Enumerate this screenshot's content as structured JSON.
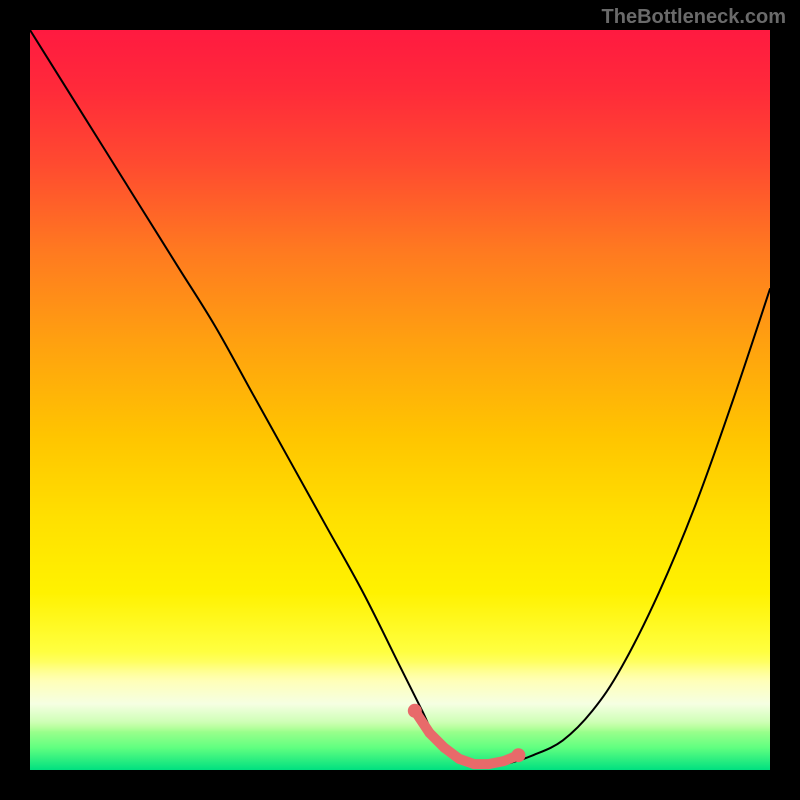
{
  "watermark": "TheBottleneck.com",
  "chart_data": {
    "type": "line",
    "title": "",
    "xlabel": "",
    "ylabel": "",
    "xlim": [
      0,
      100
    ],
    "ylim": [
      0,
      100
    ],
    "grid": false,
    "legend": false,
    "series": [
      {
        "name": "bottleneck-curve",
        "x": [
          0,
          5,
          10,
          15,
          20,
          25,
          30,
          35,
          40,
          45,
          50,
          53,
          55,
          58,
          60,
          62,
          65,
          68,
          72,
          76,
          80,
          85,
          90,
          95,
          100
        ],
        "values": [
          100,
          92,
          84,
          76,
          68,
          60,
          51,
          42,
          33,
          24,
          14,
          8,
          4,
          1.5,
          0.5,
          0.5,
          1,
          2,
          4,
          8,
          14,
          24,
          36,
          50,
          65
        ]
      }
    ],
    "markers": {
      "name": "highlight-points",
      "color": "#e86a6a",
      "x": [
        52,
        54,
        56,
        58,
        60,
        62,
        64,
        66
      ],
      "values": [
        8,
        5,
        3,
        1.5,
        0.8,
        0.8,
        1.2,
        2
      ]
    },
    "background_gradient": {
      "top_color": "#ff1a40",
      "mid_color": "#ffe000",
      "bottom_color": "#00e080"
    }
  }
}
